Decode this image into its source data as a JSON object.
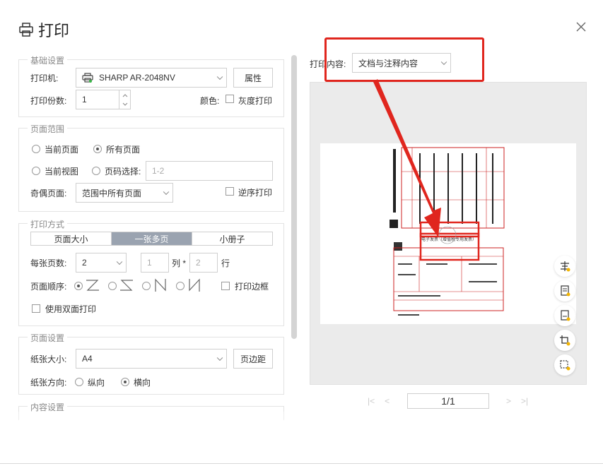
{
  "dialog": {
    "title": "打印",
    "close_icon": "close-icon"
  },
  "basic": {
    "section_title": "基础设置",
    "printer_label": "打印机:",
    "printer_value": "SHARP AR-2048NV",
    "properties_button": "属性",
    "copies_label": "打印份数:",
    "copies_value": "1",
    "color_label": "颜色:",
    "grayscale_label": "灰度打印"
  },
  "range": {
    "section_title": "页面范围",
    "current_page": "当前页面",
    "all_pages": "所有页面",
    "current_view": "当前视图",
    "page_select": "页码选择:",
    "page_select_placeholder": "1-2",
    "odd_even_label": "奇偶页面:",
    "odd_even_value": "范围中所有页面",
    "reverse_label": "逆序打印"
  },
  "mode": {
    "section_title": "打印方式",
    "tabs": [
      "页面大小",
      "一张多页",
      "小册子"
    ],
    "active_tab": "一张多页",
    "pages_per_sheet_label": "每张页数:",
    "pages_per_sheet_value": "2",
    "cols_value": "1",
    "cols_label": "列 *",
    "rows_value": "2",
    "rows_label": "行",
    "order_label": "页面顺序:",
    "print_border_label": "打印边框",
    "duplex_label": "使用双面打印"
  },
  "page_setup": {
    "section_title": "页面设置",
    "paper_size_label": "纸张大小:",
    "paper_size_value": "A4",
    "margins_button": "页边距",
    "orientation_label": "纸张方向:",
    "portrait": "纵向",
    "landscape": "横向"
  },
  "content": {
    "section_title": "内容设置"
  },
  "preview": {
    "content_label": "打印内容:",
    "content_value": "文档与注释内容",
    "page_indicator": "1/1",
    "doc_header": "电子发票（增值税专用发票）",
    "annotation_color": "#e0261e"
  }
}
